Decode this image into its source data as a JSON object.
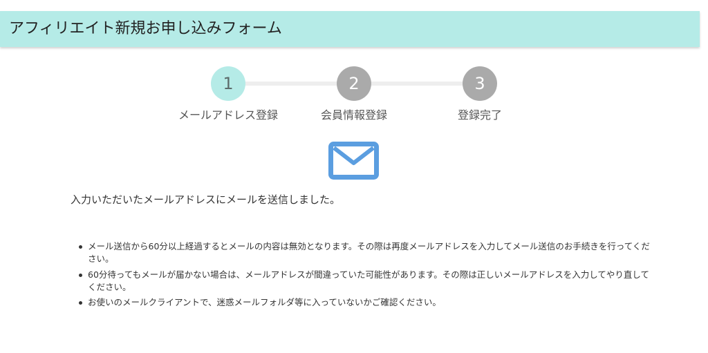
{
  "header": {
    "title": "アフィリエイト新規お申し込みフォーム"
  },
  "steps": [
    {
      "number": "1",
      "label": "メールアドレス登録",
      "state": "active"
    },
    {
      "number": "2",
      "label": "会員情報登録",
      "state": "inactive"
    },
    {
      "number": "3",
      "label": "登録完了",
      "state": "inactive"
    }
  ],
  "mail_icon": {
    "icon": "envelope-icon",
    "color": "#5b9ee0"
  },
  "message": "入力いただいたメールアドレスにメールを送信しました。",
  "notes": [
    "メール送信から60分以上経過するとメールの内容は無効となります。その際は再度メールアドレスを入力してメール送信のお手続きを行ってください。",
    "60分待ってもメールが届かない場合は、メールアドレスが間違っていた可能性があります。その際は正しいメールアドレスを入力してやり直してください。",
    "お使いのメールクライアントで、迷惑メールフォルダ等に入っていないかご確認ください。"
  ],
  "colors": {
    "header_bg": "#b5ebe7",
    "step_active": "#b5ebe7",
    "step_inactive": "#aaaaaa",
    "mail_icon": "#5b9ee0"
  }
}
